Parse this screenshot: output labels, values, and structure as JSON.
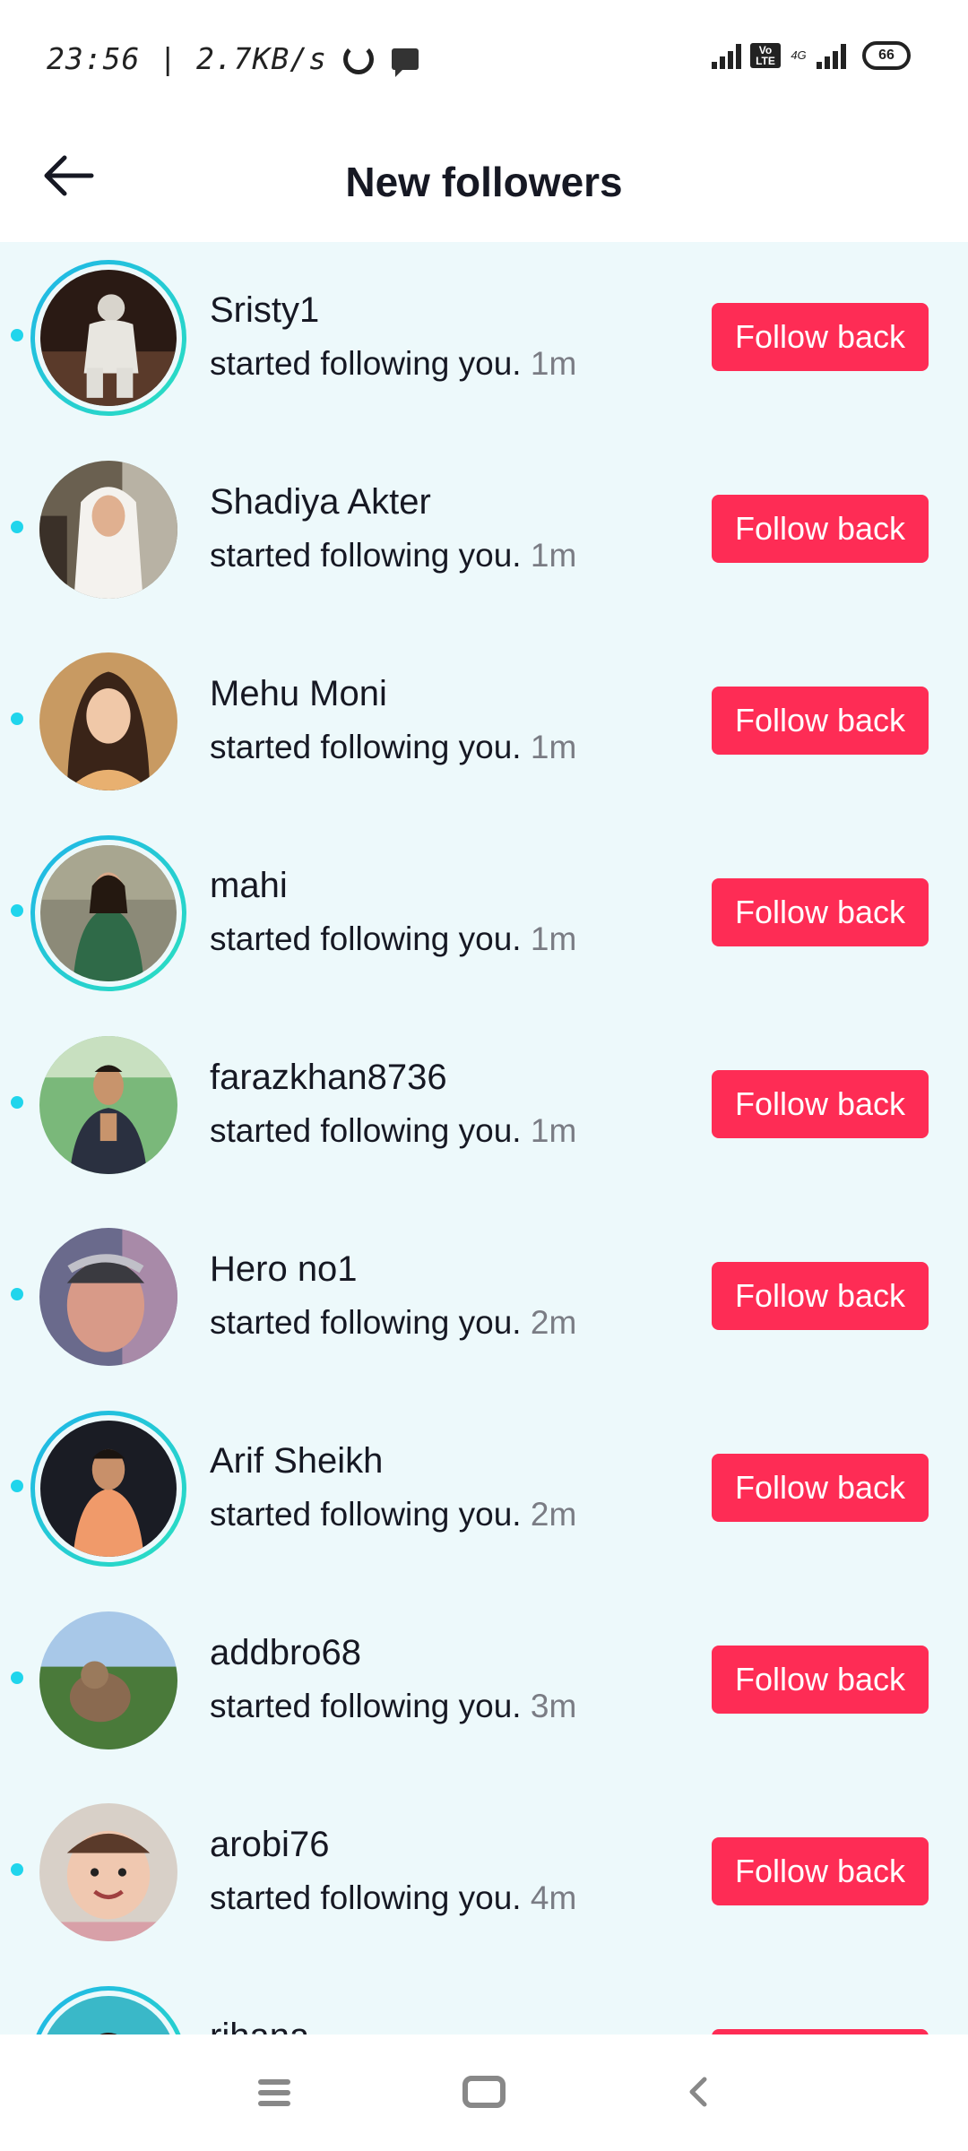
{
  "status_bar": {
    "time_speed": "23:56 | 2.7KB/s",
    "volte": "Vo LTE",
    "network": "4G",
    "battery": "66"
  },
  "header": {
    "title": "New followers"
  },
  "followers": [
    {
      "name": "Sristy1",
      "activity": "started following you.",
      "time": "1m",
      "button": "Follow back",
      "story_ring": true,
      "avatar": "dark-hooded-person"
    },
    {
      "name": "Shadiya Akter",
      "activity": "started following you.",
      "time": "1m",
      "button": "Follow back",
      "story_ring": false,
      "avatar": "girl-white-hijab"
    },
    {
      "name": "Mehu Moni",
      "activity": "started following you.",
      "time": "1m",
      "button": "Follow back",
      "story_ring": false,
      "avatar": "woman-smiling"
    },
    {
      "name": "mahi",
      "activity": "started following you.",
      "time": "1m",
      "button": "Follow back",
      "story_ring": true,
      "avatar": "woman-green-saree"
    },
    {
      "name": "farazkhan8736",
      "activity": "started following you.",
      "time": "1m",
      "button": "Follow back",
      "story_ring": false,
      "avatar": "man-greeting-outdoors"
    },
    {
      "name": "Hero no1",
      "activity": "started following you.",
      "time": "2m",
      "button": "Follow back",
      "story_ring": false,
      "avatar": "man-selfie"
    },
    {
      "name": "Arif Sheikh",
      "activity": "started following you.",
      "time": "2m",
      "button": "Follow back",
      "story_ring": true,
      "avatar": "boy-orange-shirt"
    },
    {
      "name": "addbro68",
      "activity": "started following you.",
      "time": "3m",
      "button": "Follow back",
      "story_ring": false,
      "avatar": "monkey-trees"
    },
    {
      "name": "arobi76",
      "activity": "started following you.",
      "time": "4m",
      "button": "Follow back",
      "story_ring": false,
      "avatar": "smiling-baby"
    },
    {
      "name": "rihana",
      "activity": "",
      "time": "",
      "button": "",
      "story_ring": true,
      "avatar": "woman-partial"
    }
  ],
  "colors": {
    "accent": "#fe2c55",
    "list_background": "#edf9fb",
    "unread_dot": "#20d5ec",
    "story_ring": "#1fb5e8"
  },
  "nav_icons": [
    "menu-icon",
    "home-icon",
    "back-icon"
  ]
}
